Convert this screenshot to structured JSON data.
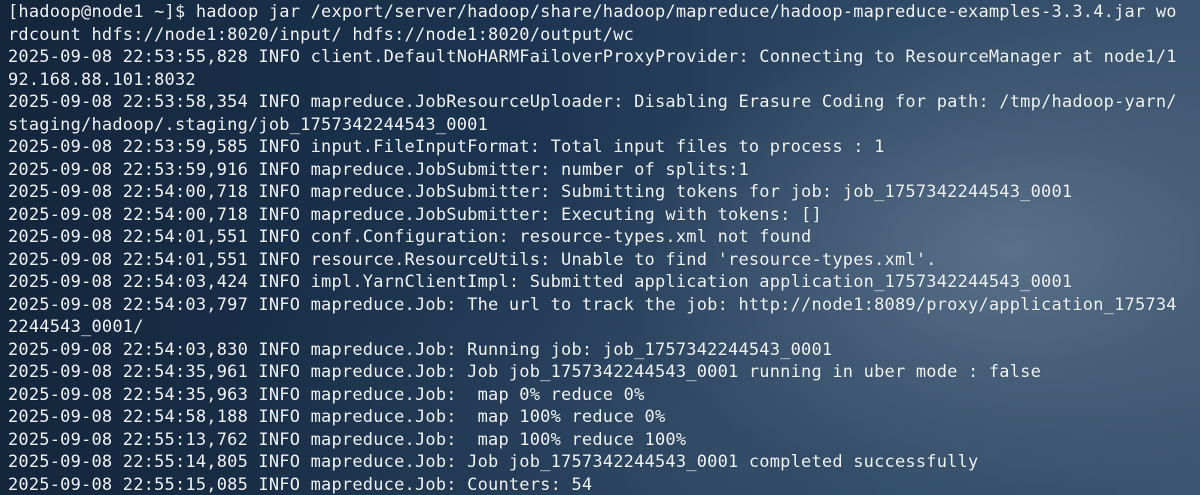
{
  "terminal": {
    "lines": [
      "[hadoop@node1 ~]$ hadoop jar /export/server/hadoop/share/hadoop/mapreduce/hadoop-mapreduce-examples-3.3.4.jar wo",
      "rdcount hdfs://node1:8020/input/ hdfs://node1:8020/output/wc",
      "2025-09-08 22:53:55,828 INFO client.DefaultNoHARMFailoverProxyProvider: Connecting to ResourceManager at node1/1",
      "92.168.88.101:8032",
      "2025-09-08 22:53:58,354 INFO mapreduce.JobResourceUploader: Disabling Erasure Coding for path: /tmp/hadoop-yarn/",
      "staging/hadoop/.staging/job_1757342244543_0001",
      "2025-09-08 22:53:59,585 INFO input.FileInputFormat: Total input files to process : 1",
      "2025-09-08 22:53:59,916 INFO mapreduce.JobSubmitter: number of splits:1",
      "2025-09-08 22:54:00,718 INFO mapreduce.JobSubmitter: Submitting tokens for job: job_1757342244543_0001",
      "2025-09-08 22:54:00,718 INFO mapreduce.JobSubmitter: Executing with tokens: []",
      "2025-09-08 22:54:01,551 INFO conf.Configuration: resource-types.xml not found",
      "2025-09-08 22:54:01,551 INFO resource.ResourceUtils: Unable to find 'resource-types.xml'.",
      "2025-09-08 22:54:03,424 INFO impl.YarnClientImpl: Submitted application application_1757342244543_0001",
      "2025-09-08 22:54:03,797 INFO mapreduce.Job: The url to track the job: http://node1:8089/proxy/application_175734",
      "2244543_0001/",
      "2025-09-08 22:54:03,830 INFO mapreduce.Job: Running job: job_1757342244543_0001",
      "2025-09-08 22:54:35,961 INFO mapreduce.Job: Job job_1757342244543_0001 running in uber mode : false",
      "2025-09-08 22:54:35,963 INFO mapreduce.Job:  map 0% reduce 0%",
      "2025-09-08 22:54:58,188 INFO mapreduce.Job:  map 100% reduce 0%",
      "2025-09-08 22:55:13,762 INFO mapreduce.Job:  map 100% reduce 100%",
      "2025-09-08 22:55:14,805 INFO mapreduce.Job: Job job_1757342244543_0001 completed successfully",
      "2025-09-08 22:55:15,085 INFO mapreduce.Job: Counters: 54"
    ]
  }
}
